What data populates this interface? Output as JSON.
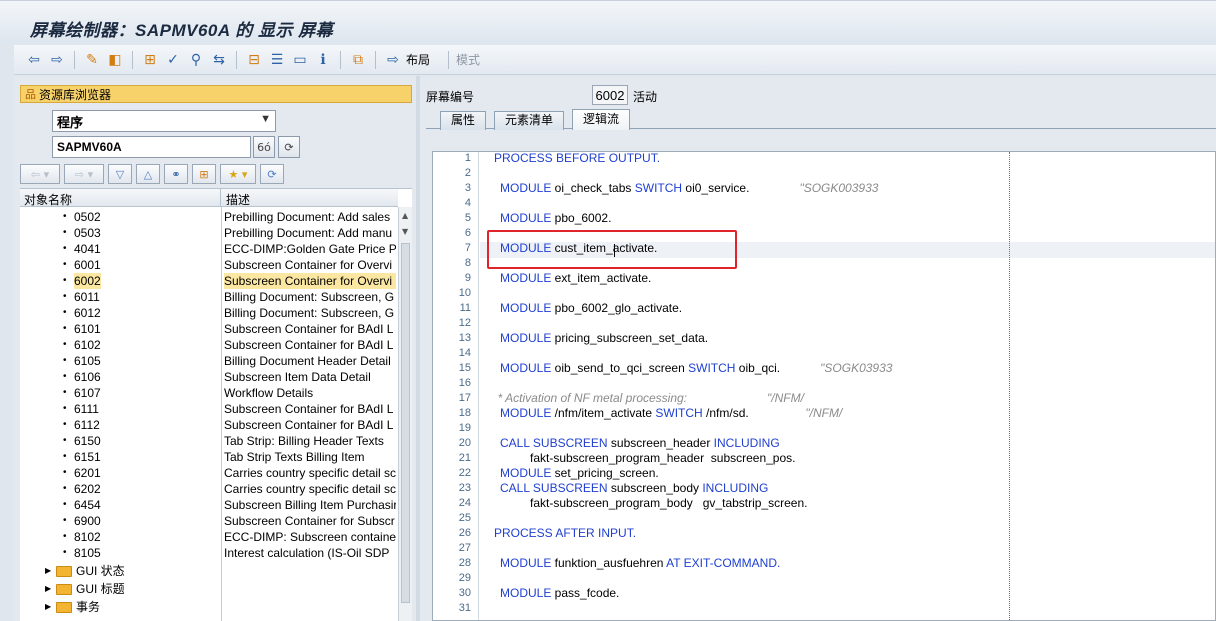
{
  "window": {
    "title": "屏幕绘制器：SAPMV60A 的 显示 屏幕"
  },
  "toolbar": {
    "layout_label": "布局",
    "mode_label": "模式",
    "icons": [
      "back-arrow-icon",
      "forward-arrow-icon",
      "display-change-icon",
      "other-object-icon",
      "hierarchy-icon",
      "check-icon",
      "activate-icon",
      "where-used-icon",
      "element-list-icon",
      "layout-icon",
      "info-icon",
      "test-icon",
      "layout-arrow-icon"
    ]
  },
  "library": {
    "header": "资源库浏览器",
    "object_type": "程序",
    "object_name": "SAPMV60A",
    "columns": [
      "对象名称",
      "描述"
    ],
    "rows": [
      {
        "name": "0502",
        "desc": "Prebilling Document: Add sales"
      },
      {
        "name": "0503",
        "desc": "Prebilling Document: Add manu"
      },
      {
        "name": "4041",
        "desc": "ECC-DIMP:Golden Gate Price Pr"
      },
      {
        "name": "6001",
        "desc": "Subscreen Container for Overvi"
      },
      {
        "name": "6002",
        "desc": "Subscreen Container for Overvi",
        "selected": true
      },
      {
        "name": "6011",
        "desc": "Billing Document: Subscreen, G"
      },
      {
        "name": "6012",
        "desc": "Billing Document: Subscreen, G"
      },
      {
        "name": "6101",
        "desc": "Subscreen Container for BAdI L"
      },
      {
        "name": "6102",
        "desc": "Subscreen Container for BAdI L"
      },
      {
        "name": "6105",
        "desc": "Billing Document Header Detail"
      },
      {
        "name": "6106",
        "desc": "Subscreen Item Data Detail"
      },
      {
        "name": "6107",
        "desc": "Workflow Details"
      },
      {
        "name": "6111",
        "desc": "Subscreen Container for BAdI L"
      },
      {
        "name": "6112",
        "desc": "Subscreen Container for BAdI L"
      },
      {
        "name": "6150",
        "desc": "Tab Strip: Billing Header Texts"
      },
      {
        "name": "6151",
        "desc": "Tab Strip Texts Billing Item"
      },
      {
        "name": "6201",
        "desc": "Carries country specific detail sc"
      },
      {
        "name": "6202",
        "desc": "Carries country specific detail sc"
      },
      {
        "name": "6454",
        "desc": "Subscreen Billing Item Purchasir"
      },
      {
        "name": "6900",
        "desc": "Subscreen Container for Subscr"
      },
      {
        "name": "8102",
        "desc": "ECC-DIMP: Subscreen container"
      },
      {
        "name": "8105",
        "desc": "Interest calculation (IS-Oil SDP"
      }
    ],
    "folders": [
      "GUI 状态",
      "GUI 标题",
      "事务"
    ]
  },
  "screen": {
    "label": "屏幕编号",
    "number": "6002",
    "status": "活动",
    "tabs": [
      "属性",
      "元素清单",
      "逻辑流"
    ],
    "active_tab": "逻辑流"
  },
  "code": {
    "lines": [
      {
        "n": "1",
        "parts": [
          {
            "t": "PROCESS BEFORE OUTPUT.",
            "c": "kw"
          }
        ],
        "indent": 0
      },
      {
        "n": "2",
        "parts": [],
        "indent": 0
      },
      {
        "n": "3",
        "parts": [
          {
            "t": "MODULE",
            "c": "kw"
          },
          {
            "t": " oi_check_tabs ",
            "c": ""
          },
          {
            "t": "SWITCH",
            "c": "kw"
          },
          {
            "t": " oi0_service.",
            "c": ""
          },
          {
            "t": "               \"SOGK003933",
            "c": "cm"
          }
        ],
        "indent": 1
      },
      {
        "n": "4",
        "parts": [],
        "indent": 0
      },
      {
        "n": "5",
        "parts": [
          {
            "t": "MODULE",
            "c": "kw"
          },
          {
            "t": " pbo_6002.",
            "c": ""
          }
        ],
        "indent": 1
      },
      {
        "n": "6",
        "parts": [],
        "indent": 0
      },
      {
        "n": "7",
        "parts": [
          {
            "t": "MODULE",
            "c": "kw"
          },
          {
            "t": " cust_item_activate.",
            "c": ""
          }
        ],
        "indent": 1
      },
      {
        "n": "8",
        "parts": [],
        "indent": 0
      },
      {
        "n": "9",
        "parts": [
          {
            "t": "MODULE",
            "c": "kw"
          },
          {
            "t": " ext_item_activate.",
            "c": ""
          }
        ],
        "indent": 1
      },
      {
        "n": "10",
        "parts": [],
        "indent": 0
      },
      {
        "n": "11",
        "parts": [
          {
            "t": "MODULE",
            "c": "kw"
          },
          {
            "t": " pbo_6002_glo_activate.",
            "c": ""
          }
        ],
        "indent": 1
      },
      {
        "n": "12",
        "parts": [],
        "indent": 0
      },
      {
        "n": "13",
        "parts": [
          {
            "t": "MODULE",
            "c": "kw"
          },
          {
            "t": " pricing_subscreen_set_data.",
            "c": ""
          }
        ],
        "indent": 1
      },
      {
        "n": "14",
        "parts": [],
        "indent": 0
      },
      {
        "n": "15",
        "parts": [
          {
            "t": "MODULE",
            "c": "kw"
          },
          {
            "t": " oib_send_to_qci_screen ",
            "c": ""
          },
          {
            "t": "SWITCH",
            "c": "kw"
          },
          {
            "t": " oib_qci.",
            "c": ""
          },
          {
            "t": "            \"SOGK03933",
            "c": "cm"
          }
        ],
        "indent": 1
      },
      {
        "n": "16",
        "parts": [],
        "indent": 0
      },
      {
        "n": "17",
        "parts": [
          {
            "t": "* Activation of NF metal processing:",
            "c": "cm"
          },
          {
            "t": "                        \"/NFM/",
            "c": "cm"
          }
        ],
        "indent": 0.6
      },
      {
        "n": "18",
        "parts": [
          {
            "t": "MODULE",
            "c": "kw"
          },
          {
            "t": " /nfm/item_activate ",
            "c": ""
          },
          {
            "t": "SWITCH",
            "c": "kw"
          },
          {
            "t": " /nfm/sd.",
            "c": ""
          },
          {
            "t": "                 \"/NFM/",
            "c": "cm"
          }
        ],
        "indent": 1
      },
      {
        "n": "19",
        "parts": [],
        "indent": 0
      },
      {
        "n": "20",
        "parts": [
          {
            "t": "CALL SUBSCREEN",
            "c": "kw"
          },
          {
            "t": " subscreen_header ",
            "c": ""
          },
          {
            "t": "INCLUDING",
            "c": "kw"
          }
        ],
        "indent": 1
      },
      {
        "n": "21",
        "parts": [
          {
            "t": "fakt-subscreen_program_header  subscreen_pos.",
            "c": ""
          }
        ],
        "indent": 6
      },
      {
        "n": "22",
        "parts": [
          {
            "t": "MODULE",
            "c": "kw"
          },
          {
            "t": " set_pricing_screen.",
            "c": ""
          }
        ],
        "indent": 1
      },
      {
        "n": "23",
        "parts": [
          {
            "t": "CALL SUBSCREEN",
            "c": "kw"
          },
          {
            "t": " subscreen_body ",
            "c": ""
          },
          {
            "t": "INCLUDING",
            "c": "kw"
          }
        ],
        "indent": 1
      },
      {
        "n": "24",
        "parts": [
          {
            "t": "fakt-subscreen_program_body   gv_tabstrip_screen.",
            "c": ""
          }
        ],
        "indent": 6
      },
      {
        "n": "25",
        "parts": [],
        "indent": 0
      },
      {
        "n": "26",
        "parts": [
          {
            "t": "PROCESS AFTER INPUT.",
            "c": "kw"
          }
        ],
        "indent": 0
      },
      {
        "n": "27",
        "parts": [],
        "indent": 0
      },
      {
        "n": "28",
        "parts": [
          {
            "t": "MODULE",
            "c": "kw"
          },
          {
            "t": " funktion_ausfuehren ",
            "c": ""
          },
          {
            "t": "AT EXIT-COMMAND.",
            "c": "kw"
          }
        ],
        "indent": 1
      },
      {
        "n": "29",
        "parts": [],
        "indent": 0
      },
      {
        "n": "30",
        "parts": [
          {
            "t": "MODULE",
            "c": "kw"
          },
          {
            "t": " pass_fcode.",
            "c": ""
          }
        ],
        "indent": 1
      },
      {
        "n": "31",
        "parts": [],
        "indent": 0
      }
    ]
  },
  "colors": {
    "keyword": "#1f3fd0",
    "comment": "#8a8a8a",
    "selection": "#fbe7a1",
    "highlight_box": "#e0252a"
  }
}
